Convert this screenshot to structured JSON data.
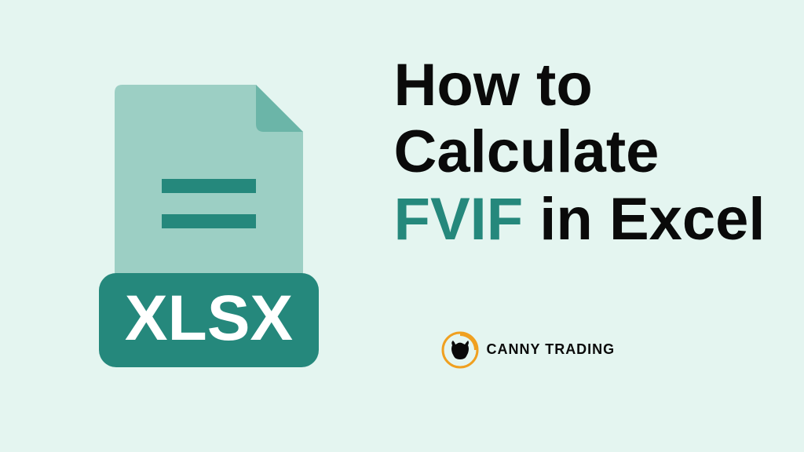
{
  "title": {
    "line1": "How to",
    "line2": "Calculate",
    "highlight": "FVIF",
    "line3_rest": " in Excel"
  },
  "file_badge": {
    "text": "XLSX"
  },
  "logo": {
    "text": "CANNY TRADING"
  },
  "colors": {
    "background": "#e4f5f0",
    "teal_dark": "#25887c",
    "teal_light": "#9ccfc4",
    "teal_fold": "#6bb5a8",
    "text": "#0a0a0a",
    "gold": "#f0a020"
  }
}
